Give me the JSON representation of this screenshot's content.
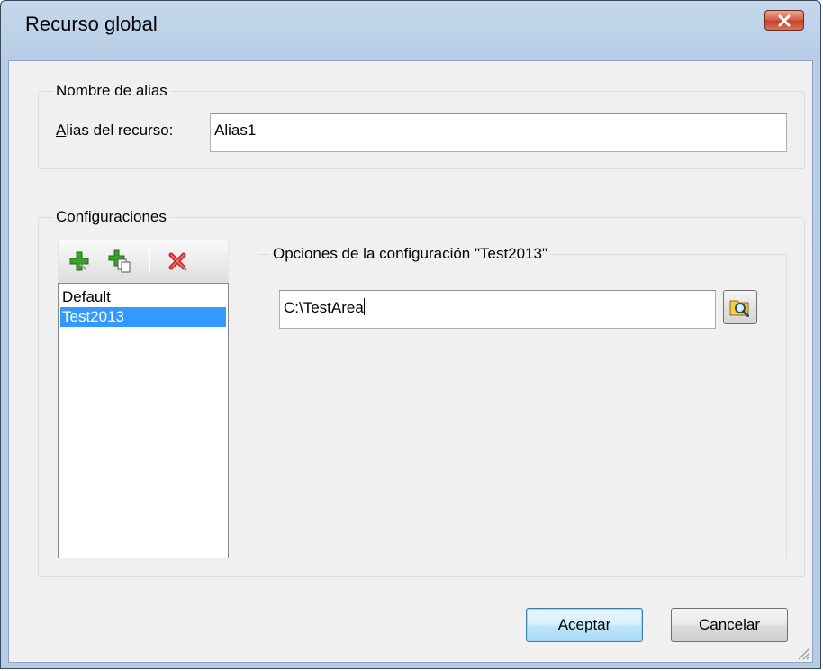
{
  "window": {
    "title": "Recurso global",
    "close_icon": "close-icon"
  },
  "alias_group": {
    "legend": "Nombre de alias",
    "alias_label_accel": "A",
    "alias_label_rest": "lias del recurso:",
    "alias_value": "Alias1"
  },
  "config_group": {
    "legend": "Configuraciones",
    "toolbar": {
      "add_icon": "add-config-icon",
      "copy_icon": "copy-config-icon",
      "delete_icon": "delete-config-icon"
    },
    "items": [
      {
        "label": "Default",
        "selected": false
      },
      {
        "label": "Test2013",
        "selected": true
      }
    ],
    "options_legend": "Opciones de la configuración \"Test2013\"",
    "path_value": "C:\\TestArea",
    "browse_icon": "browse-folder-icon"
  },
  "buttons": {
    "ok_label": "Aceptar",
    "cancel_label": "Cancelar"
  },
  "colors": {
    "selection": "#3399ff",
    "title_bg": "#b9cee6",
    "close_button": "#c2442c"
  }
}
